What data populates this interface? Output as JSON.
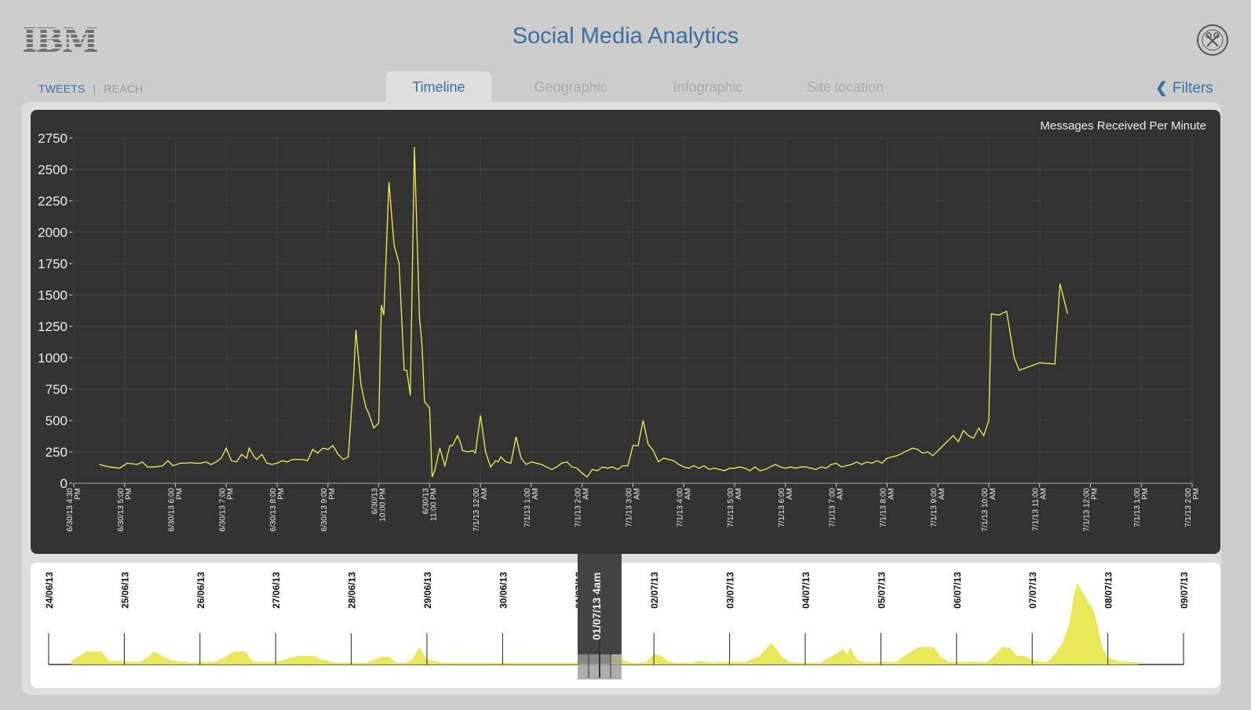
{
  "header": {
    "logo": "IBM",
    "title": "Social Media Analytics",
    "emblem_icon": "wimbledon-emblem-icon"
  },
  "mode_switch": {
    "active": "TWEETS",
    "separator": "|",
    "inactive": "REACH"
  },
  "tabs": [
    {
      "label": "Timeline",
      "active": true
    },
    {
      "label": "Geographic",
      "active": false
    },
    {
      "label": "Infographic",
      "active": false
    },
    {
      "label": "Site location",
      "active": false
    }
  ],
  "filters": {
    "label": "Filters",
    "icon": "chevron-left-icon"
  },
  "colors": {
    "accent": "#3b6fa0",
    "line": "#f0f050",
    "chart_bg": "#333333",
    "area": "#e8e858"
  },
  "chart_data": [
    {
      "type": "line",
      "title": "Messages Received Per Minute",
      "ylim": [
        0,
        2750
      ],
      "yticks": [
        0,
        250,
        500,
        750,
        1000,
        1250,
        1500,
        1750,
        2000,
        2250,
        2500,
        2750
      ],
      "xticks": [
        [
          "6/30/13 4:30",
          "PM"
        ],
        [
          "6/30/13 5:00",
          "PM"
        ],
        [
          "6/30/13 6:00",
          "PM"
        ],
        [
          "6/30/13 7:00",
          "PM"
        ],
        [
          "6/30/13 8:00",
          "PM"
        ],
        [
          "6/30/13 9:00",
          "PM"
        ],
        [
          "6/30/13",
          "10:00 PM"
        ],
        [
          "6/30/13",
          "11:00 PM"
        ],
        [
          "7/1/13 12:00",
          "AM"
        ],
        [
          "7/1/13 1:00",
          "AM"
        ],
        [
          "7/1/13 2:00",
          "AM"
        ],
        [
          "7/1/13 3:00",
          "AM"
        ],
        [
          "7/1/13 4:00",
          "AM"
        ],
        [
          "7/1/13 5:00",
          "AM"
        ],
        [
          "7/1/13 6:00",
          "AM"
        ],
        [
          "7/1/13 7:00",
          "AM"
        ],
        [
          "7/1/13 8:00",
          "AM"
        ],
        [
          "7/1/13 9:00",
          "AM"
        ],
        [
          "7/1/13 10:00",
          "AM"
        ],
        [
          "7/1/13 11:00",
          "AM"
        ],
        [
          "7/1/13 12:00",
          "PM"
        ],
        [
          "7/1/13 1:00",
          "PM"
        ],
        [
          "7/1/13 2:00",
          "PM"
        ]
      ],
      "grid": true,
      "series": [
        {
          "x_hours": [
            0.5,
            0.7,
            0.9,
            1.05,
            1.25,
            1.35,
            1.45,
            1.5,
            1.6,
            1.75,
            1.85,
            1.95,
            2.1,
            2.2,
            2.3,
            2.4,
            2.5,
            2.6,
            2.7,
            2.8,
            2.9,
            3.0,
            3.1,
            3.2,
            3.3,
            3.4,
            3.45,
            3.55,
            3.6,
            3.7,
            3.8,
            3.9,
            4.0,
            4.1,
            4.2,
            4.3,
            4.4,
            4.5,
            4.6,
            4.7,
            4.8,
            4.9,
            5.0,
            5.1,
            5.2,
            5.3,
            5.4,
            5.5,
            5.55,
            5.65,
            5.75,
            5.8,
            5.9,
            6.0,
            6.05,
            6.1,
            6.2,
            6.3,
            6.4,
            6.5,
            6.55,
            6.62,
            6.7,
            6.8,
            6.85,
            6.9,
            7.0,
            7.05,
            7.1,
            7.2,
            7.3,
            7.4,
            7.45,
            7.55,
            7.6,
            7.65,
            7.75,
            7.85,
            7.9,
            8.0,
            8.1,
            8.2,
            8.3,
            8.35,
            8.4,
            8.5,
            8.6,
            8.7,
            8.8,
            8.9,
            9.0,
            9.1,
            9.2,
            9.3,
            9.4,
            9.5,
            9.6,
            9.7,
            9.8,
            9.9,
            10.0,
            10.1,
            10.2,
            10.3,
            10.4,
            10.5,
            10.6,
            10.7,
            10.8,
            10.9,
            11.0,
            11.1,
            11.2,
            11.3,
            11.4,
            11.5,
            11.6,
            11.7,
            11.8,
            11.9,
            12.0,
            12.1,
            12.2,
            12.3,
            12.4,
            12.5,
            12.6,
            12.7,
            12.8,
            12.9,
            13.0,
            13.1,
            13.2,
            13.3,
            13.4,
            13.5,
            13.6,
            13.7,
            13.8,
            13.9,
            14.0,
            14.1,
            14.2,
            14.3,
            14.4,
            14.5,
            14.6,
            14.7,
            14.8,
            14.9,
            15.0,
            15.1,
            15.2,
            15.3,
            15.4,
            15.5,
            15.6,
            15.7,
            15.8,
            15.9,
            16.0,
            16.1,
            16.2,
            16.3,
            16.4,
            16.5,
            16.6,
            16.7,
            16.8,
            16.9,
            17.0,
            17.1,
            17.2,
            17.3,
            17.4,
            17.5,
            17.6,
            17.7,
            17.8,
            17.9,
            18.0,
            18.05,
            18.2,
            18.35,
            18.5,
            18.6,
            19.0,
            19.3,
            19.4,
            19.55,
            19.7,
            19.85,
            20.0,
            20.05,
            20.15,
            20.2,
            20.35,
            20.5,
            20.55,
            20.7,
            20.75,
            20.85,
            20.9,
            20.95
          ],
          "values": [
            150,
            130,
            120,
            160,
            150,
            170,
            130,
            130,
            130,
            140,
            180,
            140,
            160,
            160,
            165,
            160,
            160,
            170,
            150,
            170,
            200,
            280,
            180,
            170,
            230,
            200,
            280,
            210,
            190,
            230,
            160,
            150,
            160,
            180,
            170,
            190,
            190,
            190,
            180,
            270,
            240,
            280,
            270,
            300,
            230,
            190,
            210,
            800,
            1220,
            780,
            600,
            560,
            440,
            480,
            1420,
            1340,
            2400,
            1900,
            1750,
            900,
            900,
            700,
            2680,
            1320,
            1100,
            650,
            600,
            50,
            100,
            280,
            140,
            300,
            300,
            380,
            330,
            260,
            250,
            260,
            240,
            540,
            250,
            130,
            180,
            170,
            210,
            170,
            160,
            370,
            200,
            150,
            170,
            160,
            150,
            130,
            110,
            130,
            160,
            170,
            130,
            120,
            80,
            50,
            110,
            100,
            130,
            120,
            130,
            110,
            140,
            140,
            300,
            300,
            500,
            310,
            260,
            170,
            200,
            190,
            180,
            150,
            130,
            120,
            140,
            120,
            140,
            110,
            120,
            110,
            100,
            120,
            120,
            130,
            120,
            100,
            130,
            100,
            110,
            130,
            150,
            130,
            120,
            130,
            120,
            130,
            130,
            120,
            110,
            130,
            120,
            150,
            160,
            130,
            140,
            150,
            170,
            150,
            170,
            160,
            180,
            160,
            200,
            210,
            220,
            240,
            260,
            280,
            270,
            240,
            250,
            220,
            260,
            300,
            340,
            380,
            330,
            420,
            380,
            360,
            440,
            380,
            500,
            1350,
            1340,
            1370,
            1000,
            900,
            960,
            950,
            1590,
            1350
          ]
        }
      ]
    },
    {
      "type": "area",
      "xticks": [
        "24/06/13",
        "25/06/13",
        "26/06/13",
        "27/06/13",
        "28/06/13",
        "29/06/13",
        "30/06/13",
        "01/07/13",
        "02/07/13",
        "03/07/13",
        "04/07/13",
        "05/07/13",
        "06/07/13",
        "07/07/13",
        "08/07/13",
        "09/07/13"
      ],
      "selected_range_label": "01/07/13 4am",
      "series": [
        {
          "x_days": [
            0.3,
            0.5,
            0.6,
            0.7,
            0.8,
            0.95,
            1.0,
            1.05,
            1.2,
            1.3,
            1.4,
            1.5,
            1.6,
            1.7,
            1.8,
            1.9,
            2.0,
            2.2,
            2.4,
            2.45,
            2.55,
            2.6,
            2.7,
            2.8,
            3.0,
            3.2,
            3.3,
            3.4,
            3.5,
            3.6,
            3.8,
            4.0,
            4.2,
            4.4,
            4.5,
            4.6,
            4.7,
            4.8,
            4.9,
            5.0,
            5.2,
            5.4,
            5.5,
            5.55,
            5.65,
            5.7,
            5.8,
            5.9,
            6.0,
            6.1,
            6.2,
            6.5,
            6.8,
            7.0,
            7.05,
            7.1,
            7.15,
            7.2,
            7.25,
            7.3,
            7.35,
            7.45,
            7.5,
            7.55,
            7.6,
            7.65,
            7.7,
            7.8,
            7.9,
            8.0,
            8.1,
            8.2,
            8.3,
            8.4,
            8.5,
            8.6,
            8.7,
            8.8,
            8.9,
            9.0,
            9.2,
            9.4,
            9.5,
            9.55,
            9.6,
            9.7,
            9.8,
            9.9,
            10.0,
            10.2,
            10.4,
            10.5,
            10.55,
            10.6,
            10.65,
            10.7,
            10.8,
            10.9,
            11.0,
            11.2,
            11.4,
            11.5,
            11.55,
            11.6,
            11.7,
            11.8,
            11.9,
            12.0,
            12.2,
            12.4,
            12.5,
            12.6,
            12.7,
            12.8,
            12.9,
            13.0,
            13.1,
            13.2,
            13.3,
            13.4,
            13.5,
            13.55,
            13.6,
            13.65,
            13.7,
            13.75,
            13.8,
            13.85,
            13.9,
            13.95,
            14.0,
            14.1,
            14.2,
            14.4
          ],
          "values": [
            0.04,
            0.15,
            0.15,
            0.15,
            0.04,
            0.04,
            0.04,
            0.03,
            0.03,
            0.08,
            0.15,
            0.1,
            0.05,
            0.04,
            0.03,
            0.02,
            0.03,
            0.03,
            0.12,
            0.15,
            0.15,
            0.15,
            0.03,
            0.03,
            0.03,
            0.08,
            0.1,
            0.1,
            0.1,
            0.06,
            0.02,
            0.02,
            0.02,
            0.09,
            0.09,
            0.02,
            0.02,
            0.05,
            0.2,
            0.06,
            0.02,
            0.02,
            0.02,
            0.02,
            0.02,
            0.02,
            0.02,
            0.02,
            0.02,
            0.02,
            0.02,
            0.02,
            0.02,
            0.02,
            0.01,
            0.01,
            0.02,
            0.02,
            0.01,
            0.08,
            0.2,
            0.15,
            0.08,
            0.15,
            0.05,
            0.03,
            0.02,
            0.02,
            0.03,
            0.12,
            0.1,
            0.03,
            0.02,
            0.02,
            0.02,
            0.04,
            0.03,
            0.02,
            0.03,
            0.03,
            0.03,
            0.1,
            0.2,
            0.25,
            0.2,
            0.08,
            0.03,
            0.02,
            0.02,
            0.02,
            0.12,
            0.18,
            0.12,
            0.2,
            0.1,
            0.04,
            0.03,
            0.02,
            0.03,
            0.03,
            0.15,
            0.2,
            0.2,
            0.2,
            0.2,
            0.08,
            0.03,
            0.03,
            0.03,
            0.03,
            0.1,
            0.2,
            0.2,
            0.1,
            0.1,
            0.05,
            0.03,
            0.03,
            0.12,
            0.25,
            0.5,
            0.8,
            0.95,
            0.85,
            0.8,
            0.7,
            0.65,
            0.5,
            0.3,
            0.15,
            0.08,
            0.05,
            0.03,
            0.03
          ]
        }
      ]
    }
  ]
}
